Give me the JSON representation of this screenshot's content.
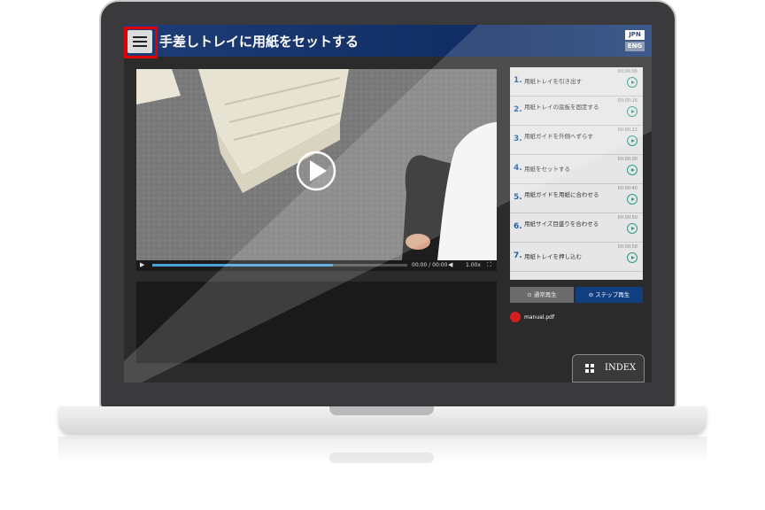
{
  "header": {
    "title": "手差しトレイに用紙をセットする",
    "lang_jpn": "JPN",
    "lang_eng": "ENG"
  },
  "player": {
    "time": "00:00 / 00:00",
    "speed": "1.00x",
    "progress": 0.71
  },
  "steps": [
    {
      "num": "1.",
      "label": "用紙トレイを引き出す",
      "time": "00:00:06"
    },
    {
      "num": "2.",
      "label": "用紙トレイの底板を固定する",
      "time": "00:00:16"
    },
    {
      "num": "3.",
      "label": "用紙ガイドを外側へずらす",
      "time": "00:00:22"
    },
    {
      "num": "4.",
      "label": "用紙をセットする",
      "time": "00:00:30"
    },
    {
      "num": "5.",
      "label": "用紙ガイドを用紙に合わせる",
      "time": "00:00:40"
    },
    {
      "num": "6.",
      "label": "用紙サイズ目盛りを合わせる",
      "time": "00:00:50"
    },
    {
      "num": "7.",
      "label": "用紙トレイを押し込む",
      "time": "00:00:58"
    }
  ],
  "buttons": {
    "normal_play": "通常再生",
    "step_play": "ステップ再生",
    "pdf": "manual.pdf",
    "index": "INDEX"
  },
  "colors": {
    "header_blue": "#0f2c63",
    "step_number_blue": "#1d5fa8",
    "play_icon_teal": "#2c9c8c",
    "highlight_red": "#e00000",
    "progress_blue": "#4aa0d8"
  }
}
